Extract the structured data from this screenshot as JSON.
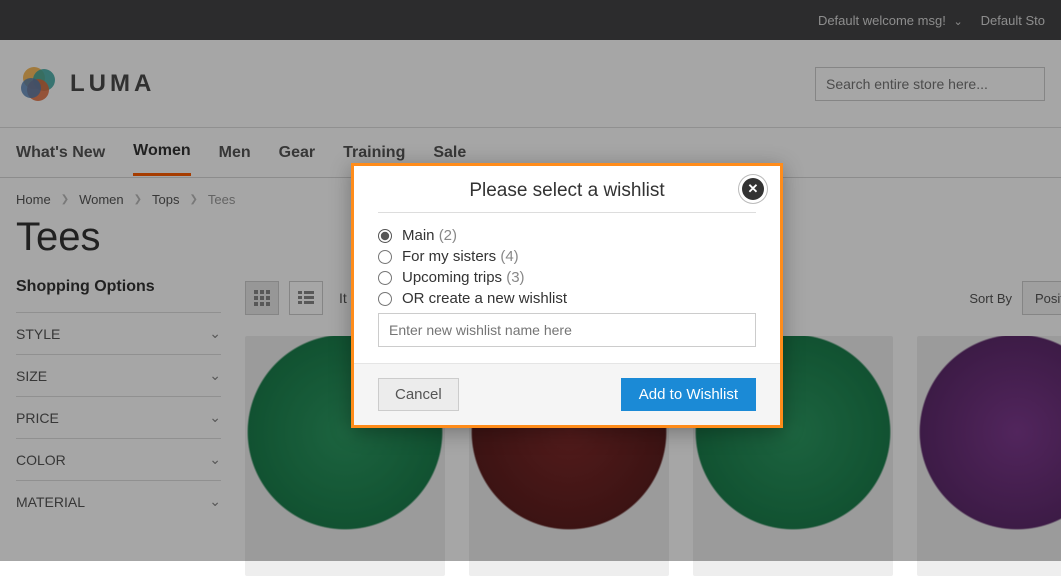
{
  "topbar": {
    "welcome": "Default welcome msg!",
    "store": "Default Sto"
  },
  "header": {
    "logo_text": "LUMA",
    "search_placeholder": "Search entire store here..."
  },
  "nav": {
    "items": [
      {
        "label": "What's New",
        "active": false
      },
      {
        "label": "Women",
        "active": true
      },
      {
        "label": "Men",
        "active": false
      },
      {
        "label": "Gear",
        "active": false
      },
      {
        "label": "Training",
        "active": false
      },
      {
        "label": "Sale",
        "active": false
      }
    ]
  },
  "breadcrumbs": {
    "items": [
      "Home",
      "Women",
      "Tops",
      "Tees"
    ]
  },
  "page": {
    "title": "Tees"
  },
  "sidebar": {
    "heading": "Shopping Options",
    "filters": [
      "STYLE",
      "SIZE",
      "PRICE",
      "COLOR",
      "MATERIAL"
    ]
  },
  "toolbar": {
    "items_label_prefix": "It",
    "sort_label": "Sort By",
    "sort_value": "Position"
  },
  "modal": {
    "title": "Please select a wishlist",
    "options": [
      {
        "label": "Main",
        "count": "(2)",
        "selected": true
      },
      {
        "label": "For my sisters",
        "count": "(4)",
        "selected": false
      },
      {
        "label": "Upcoming trips",
        "count": "(3)",
        "selected": false
      },
      {
        "label": "OR create a new wishlist",
        "count": "",
        "selected": false
      }
    ],
    "new_placeholder": "Enter new wishlist name here",
    "cancel_label": "Cancel",
    "submit_label": "Add to Wishlist"
  }
}
